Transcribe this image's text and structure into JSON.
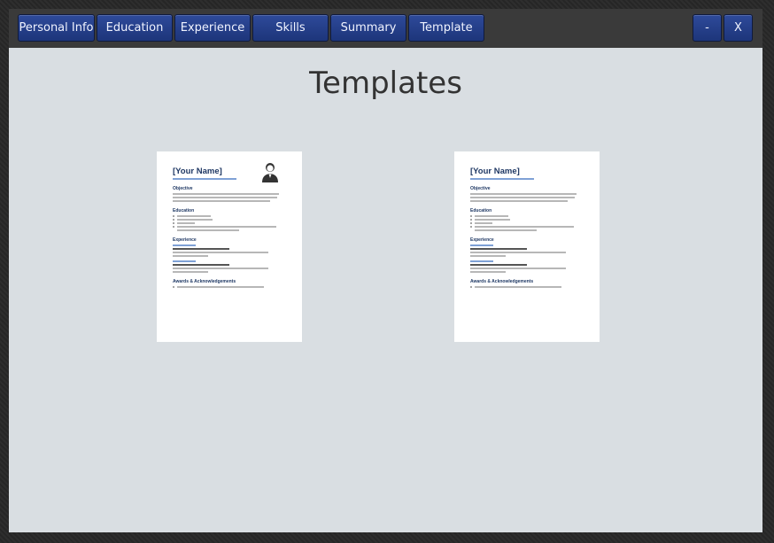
{
  "tabs": [
    {
      "label": "Personal Info"
    },
    {
      "label": "Education"
    },
    {
      "label": "Experience"
    },
    {
      "label": "Skills"
    },
    {
      "label": "Summary"
    },
    {
      "label": "Template"
    }
  ],
  "window_controls": {
    "minimize": "-",
    "close": "X"
  },
  "page_title": "Templates",
  "templates": [
    {
      "name": "[Your Name]",
      "has_photo": true,
      "sections": [
        "Objective",
        "Education",
        "Experience",
        "Awards & Acknowledgements"
      ]
    },
    {
      "name": "[Your Name]",
      "has_photo": false,
      "sections": [
        "Objective",
        "Education",
        "Experience",
        "Awards & Acknowledgements"
      ]
    }
  ]
}
